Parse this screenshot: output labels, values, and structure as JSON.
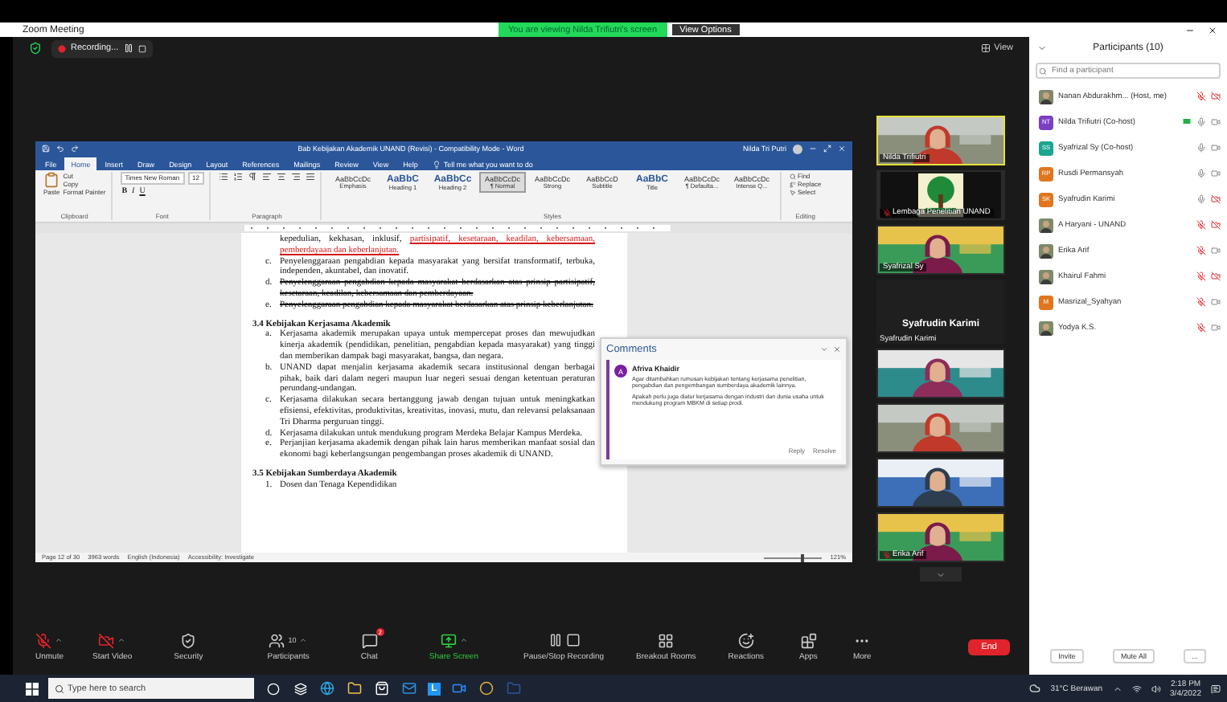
{
  "window": {
    "title": "Zoom Meeting"
  },
  "share_banner": "You are viewing Nilda Trifiutri's screen",
  "view_options": "View Options",
  "recording": {
    "label": "Recording...",
    "paused": false
  },
  "view_button": "View",
  "word": {
    "title": "Bab Kebijakan Akademik UNAND (Revisi) - Compatibility Mode - Word",
    "user": "Nilda Tri Putri",
    "tabs": [
      {
        "label": "File",
        "selected": false
      },
      {
        "label": "Home",
        "selected": true
      },
      {
        "label": "Insert",
        "selected": false
      },
      {
        "label": "Draw",
        "selected": false
      },
      {
        "label": "Design",
        "selected": false
      },
      {
        "label": "Layout",
        "selected": false
      },
      {
        "label": "References",
        "selected": false
      },
      {
        "label": "Mailings",
        "selected": false
      },
      {
        "label": "Review",
        "selected": false
      },
      {
        "label": "View",
        "selected": false
      },
      {
        "label": "Help",
        "selected": false
      }
    ],
    "tell_me": "Tell me what you want to do",
    "paste": "Paste",
    "clipboard": [
      "Cut",
      "Copy",
      "Format Painter"
    ],
    "font": "Times New Roman",
    "size": "12",
    "format_buttons": [
      "B",
      "I",
      "U"
    ],
    "styles": [
      {
        "sample": "AaBbCcDc",
        "name": "Emphasis",
        "selected": false
      },
      {
        "sample": "AaBbC",
        "name": "Heading 1",
        "selected": false
      },
      {
        "sample": "AaBbCc",
        "name": "Heading 2",
        "selected": false
      },
      {
        "sample": "AaBbCcDc",
        "name": "¶ Normal",
        "selected": true
      },
      {
        "sample": "AaBbCcDc",
        "name": "Strong",
        "selected": false
      },
      {
        "sample": "AaBbCcD",
        "name": "Subtitle",
        "selected": false
      },
      {
        "sample": "AaBbC",
        "name": "Title",
        "selected": false
      },
      {
        "sample": "AaBbCcDc",
        "name": "¶ Defaulta...",
        "selected": false
      },
      {
        "sample": "AaBbCcDc",
        "name": "Intense Q...",
        "selected": false
      }
    ],
    "editing": [
      "Find",
      "Replace",
      "Select"
    ],
    "groups": [
      "Clipboard",
      "Font",
      "Paragraph",
      "Styles",
      "Editing"
    ],
    "document": [
      {
        "kind": "item",
        "segments": [
          {
            "text": "kepedulian, kekhasan, inklusif, "
          },
          {
            "text": "partisipatif, kesetaraan, keadilan, kebersamaan, pemberdayaan dan keberlanjutan.",
            "inserted": true
          }
        ]
      },
      {
        "kind": "item",
        "marker": "c.",
        "segments": [
          {
            "text": "Penyelenggaraan pengabdian kepada masyarakat yang bersifat transformatif, terbuka, independen, akuntabel, dan inovatif."
          }
        ]
      },
      {
        "kind": "item",
        "marker": "d.",
        "segments": [
          {
            "text": "Penyelenggaraan pengabdian kepada masyarakat berdasarkan atas prinsip partisipatif, kesetaraan, keadilan, kebersamaan dan pemberdayaan.",
            "deleted": true
          }
        ]
      },
      {
        "kind": "item",
        "marker": "e.",
        "segments": [
          {
            "text": "Penyelenggaraan pengabdian kepada masyarakat berdasarkan atas prinsip keberlanjutan.",
            "deleted": true
          }
        ]
      },
      {
        "kind": "heading",
        "segments": [
          {
            "text": "3.4 Kebijakan Kerjasama Akademik"
          }
        ]
      },
      {
        "kind": "item",
        "marker": "a.",
        "segments": [
          {
            "text": "Kerjasama akademik merupakan upaya untuk mempercepat proses dan mewujudkan kinerja akademik (pendidikan, penelitian, pengabdian kepada masyarakat) yang tinggi dan memberikan dampak bagi masyarakat, bangsa, dan negara."
          }
        ]
      },
      {
        "kind": "item",
        "marker": "b.",
        "segments": [
          {
            "text": "UNAND dapat menjalin kerjasama akademik secara institusional dengan berbagai pihak, baik dari dalam negeri maupun luar negeri sesuai dengan ketentuan peraturan perundang-undangan."
          }
        ]
      },
      {
        "kind": "item",
        "marker": "c.",
        "segments": [
          {
            "text": "Kerjasama dilakukan secara bertanggung jawab dengan tujuan untuk meningkatkan efisiensi, efektivitas, produktivitas, kreativitas, inovasi, mutu, dan relevansi pelaksanaan Tri Dharma perguruan tinggi."
          }
        ]
      },
      {
        "kind": "item",
        "marker": "d.",
        "segments": [
          {
            "text": "Kerjasama dilakukan untuk mendukung program Merdeka Belajar Kampus Merdeka."
          }
        ]
      },
      {
        "kind": "item",
        "marker": "e.",
        "segments": [
          {
            "text": "Perjanjian kerjasama akademik dengan pihak lain harus memberikan manfaat sosial dan ekonomi bagi keberlangsungan pengembangan proses akademik di UNAND."
          }
        ]
      },
      {
        "kind": "heading",
        "segments": [
          {
            "text": "3.5 Kebijakan Sumberdaya Akademik"
          }
        ]
      },
      {
        "kind": "item",
        "marker": "1.",
        "segments": [
          {
            "text": "Dosen dan Tenaga Kependidikan"
          }
        ]
      }
    ],
    "status": [
      "Page 12 of 30",
      "3963 words",
      "English (Indonesia)",
      "Accessibility: Investigate"
    ],
    "zoom": "121%",
    "zoom_slider": {
      "level": 0.62
    }
  },
  "comments": {
    "title": "Comments",
    "initial": "A",
    "author": "Afriva Khaidir",
    "text": [
      "Agar ditambahkan rumusan kebijakan tentang kerjasama penelitian, pengabdian dan pengembangan sumberdaya akademik lainnya.",
      "Apakah perlu juga diatur kerjasama dengan industri dan dunia usaha untuk mendukung program MBKM di setiap prodi."
    ],
    "actions": [
      "Reply",
      "Resolve"
    ]
  },
  "videos": [
    {
      "kind": "camera",
      "name": "Nilda Trifiutri",
      "speaking": true,
      "muted": false
    },
    {
      "kind": "logo",
      "name": "Lembaga Penelitian UNAND",
      "speaking": false,
      "muted": true
    },
    {
      "kind": "camera",
      "name": "Syafrizal Sy",
      "speaking": false,
      "muted": false
    },
    {
      "kind": "name_only",
      "name": "Syafrudin Karimi",
      "label": "Syafrudin Karimi",
      "speaking": false,
      "muted": false
    },
    {
      "kind": "camera",
      "speaking": false,
      "muted": false
    },
    {
      "kind": "camera",
      "speaking": false,
      "muted": false
    },
    {
      "kind": "camera",
      "speaking": false,
      "muted": false
    },
    {
      "kind": "camera",
      "name": "Erika Arif",
      "speaking": false,
      "muted": true
    }
  ],
  "toolbar": [
    {
      "kind": "mic",
      "label": "Unmute",
      "muted": true,
      "menu": true
    },
    {
      "kind": "video",
      "label": "Start Video",
      "muted": true,
      "menu": true
    },
    {
      "kind": "security",
      "label": "Security",
      "menu": false
    },
    {
      "kind": "participants",
      "label": "Participants",
      "count": "10",
      "menu": true
    },
    {
      "kind": "chat",
      "label": "Chat",
      "badge": "2",
      "menu": false
    },
    {
      "kind": "share",
      "label": "Share Screen",
      "menu": true
    },
    {
      "kind": "recording",
      "label": "Pause/Stop Recording",
      "menu": false
    },
    {
      "kind": "breakout",
      "label": "Breakout Rooms",
      "menu": false
    },
    {
      "kind": "reactions",
      "label": "Reactions",
      "menu": false
    },
    {
      "kind": "apps",
      "label": "Apps",
      "menu": false
    },
    {
      "kind": "more",
      "label": "More",
      "menu": false
    }
  ],
  "end_button": "End",
  "participants": {
    "title": "Participants (10)",
    "search_placeholder": "Find a participant",
    "items": [
      {
        "name": "Nanan Abdurakhm... (Host, me)",
        "muted": true,
        "video_off": true,
        "sharing": false
      },
      {
        "name": "Nilda Trifiutri (Co-host)",
        "kind": "initials",
        "initials": "NT",
        "color": "#7b3fc4",
        "muted": false,
        "video_off": false,
        "sharing": true
      },
      {
        "name": "Syafrizal Sy (Co-host)",
        "kind": "initials",
        "initials": "SS",
        "color": "#1aa58e",
        "muted": false,
        "video_off": false,
        "sharing": false
      },
      {
        "name": "Rusdi Permansyah",
        "kind": "initials",
        "initials": "RP",
        "color": "#e0761e",
        "muted": false,
        "video_off": false,
        "sharing": false
      },
      {
        "name": "Syafrudin Karimi",
        "kind": "initials",
        "initials": "SK",
        "color": "#e0761e",
        "muted": false,
        "video_off": true,
        "sharing": false
      },
      {
        "name": "A Haryani - UNAND",
        "muted": true,
        "video_off": true,
        "sharing": false
      },
      {
        "name": "Erika Arif",
        "muted": true,
        "video_off": false,
        "sharing": false
      },
      {
        "name": "Khairul Fahmi",
        "muted": true,
        "video_off": true,
        "sharing": false
      },
      {
        "name": "Masrizal_Syahyan",
        "kind": "initials",
        "initials": "M",
        "color": "#e0761e",
        "muted": true,
        "video_off": false,
        "sharing": false
      },
      {
        "name": "Yodya K.S.",
        "muted": true,
        "video_off": false,
        "sharing": false
      }
    ],
    "buttons": [
      "Invite",
      "Mute All",
      "..."
    ]
  },
  "taskbar": {
    "search_placeholder": "Type here to search",
    "app_letter": "L",
    "weather": "31°C Berawan",
    "time": "2:18 PM",
    "date": "3/4/2022"
  }
}
